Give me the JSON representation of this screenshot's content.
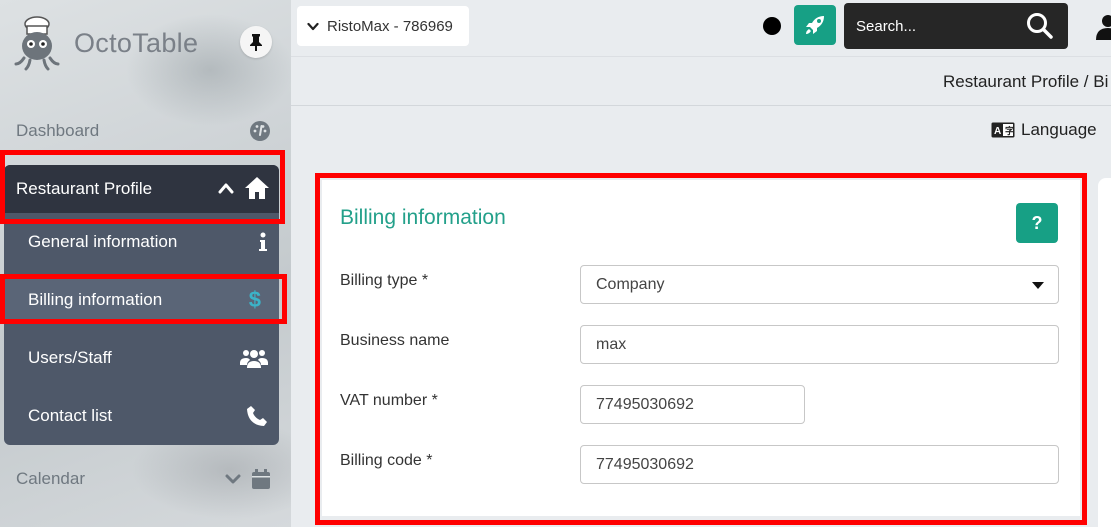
{
  "brand": {
    "name": "OctoTable"
  },
  "sidebar": {
    "dashboard": "Dashboard",
    "section": "Restaurant Profile",
    "items": [
      {
        "label": "General information",
        "icon": "info-icon"
      },
      {
        "label": "Billing information",
        "icon": "dollar-icon"
      },
      {
        "label": "Users/Staff",
        "icon": "users-icon"
      },
      {
        "label": "Contact list",
        "icon": "phone-icon"
      }
    ],
    "calendar": "Calendar"
  },
  "topbar": {
    "restaurant": "RistoMax - 786969",
    "search_placeholder": "Search..."
  },
  "breadcrumb": "Restaurant Profile / Bi",
  "language": "Language",
  "card": {
    "title": "Billing information",
    "help": "?",
    "fields": {
      "billing_type": {
        "label": "Billing type *",
        "value": "Company"
      },
      "business_name": {
        "label": "Business name",
        "value": "max"
      },
      "vat_number": {
        "label": "VAT number *",
        "value": "77495030692"
      },
      "billing_code": {
        "label": "Billing code *",
        "value": "77495030692"
      }
    }
  },
  "colors": {
    "accent": "#17a085",
    "highlight": "#ff0000",
    "submenu": "#4e5869",
    "submenu_header": "#2f3440"
  }
}
